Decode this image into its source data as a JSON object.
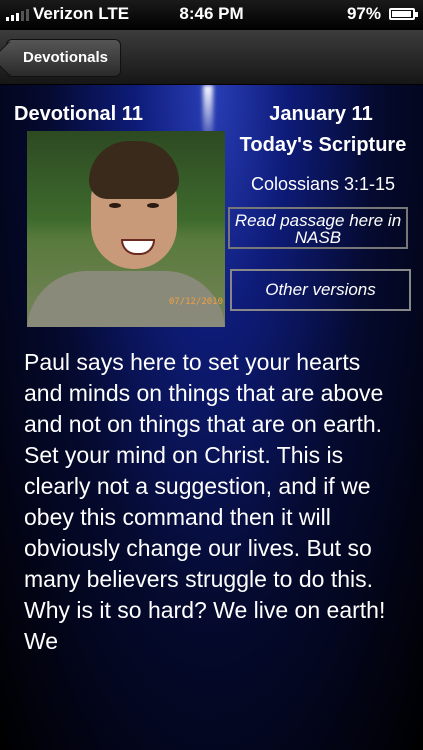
{
  "status_bar": {
    "carrier": "Verizon",
    "network": "LTE",
    "time": "8:46 PM",
    "battery_percent": "97%",
    "battery_level": 0.97
  },
  "nav": {
    "back_label": "Devotionals"
  },
  "devotional": {
    "title": "Devotional 11",
    "date": "January 11",
    "scripture_heading": "Today's Scripture",
    "scripture_reference": "Colossians 3:1-15",
    "read_passage_label": "Read passage here in NASB",
    "other_versions_label": "Other versions",
    "photo_date_stamp": "07/12/2010",
    "body": "Paul says here to set your hearts and minds on things that are above and not on things that are on earth. Set your mind on Christ. This is clearly not a suggestion, and if we obey this command then it will obviously change our lives. But so many believers struggle to do this. Why is it so hard? We live on earth! We"
  },
  "colors": {
    "background_top": "#2a3fb8",
    "background_bottom": "#000000",
    "text": "#ffffff",
    "button_border": "#777777"
  }
}
